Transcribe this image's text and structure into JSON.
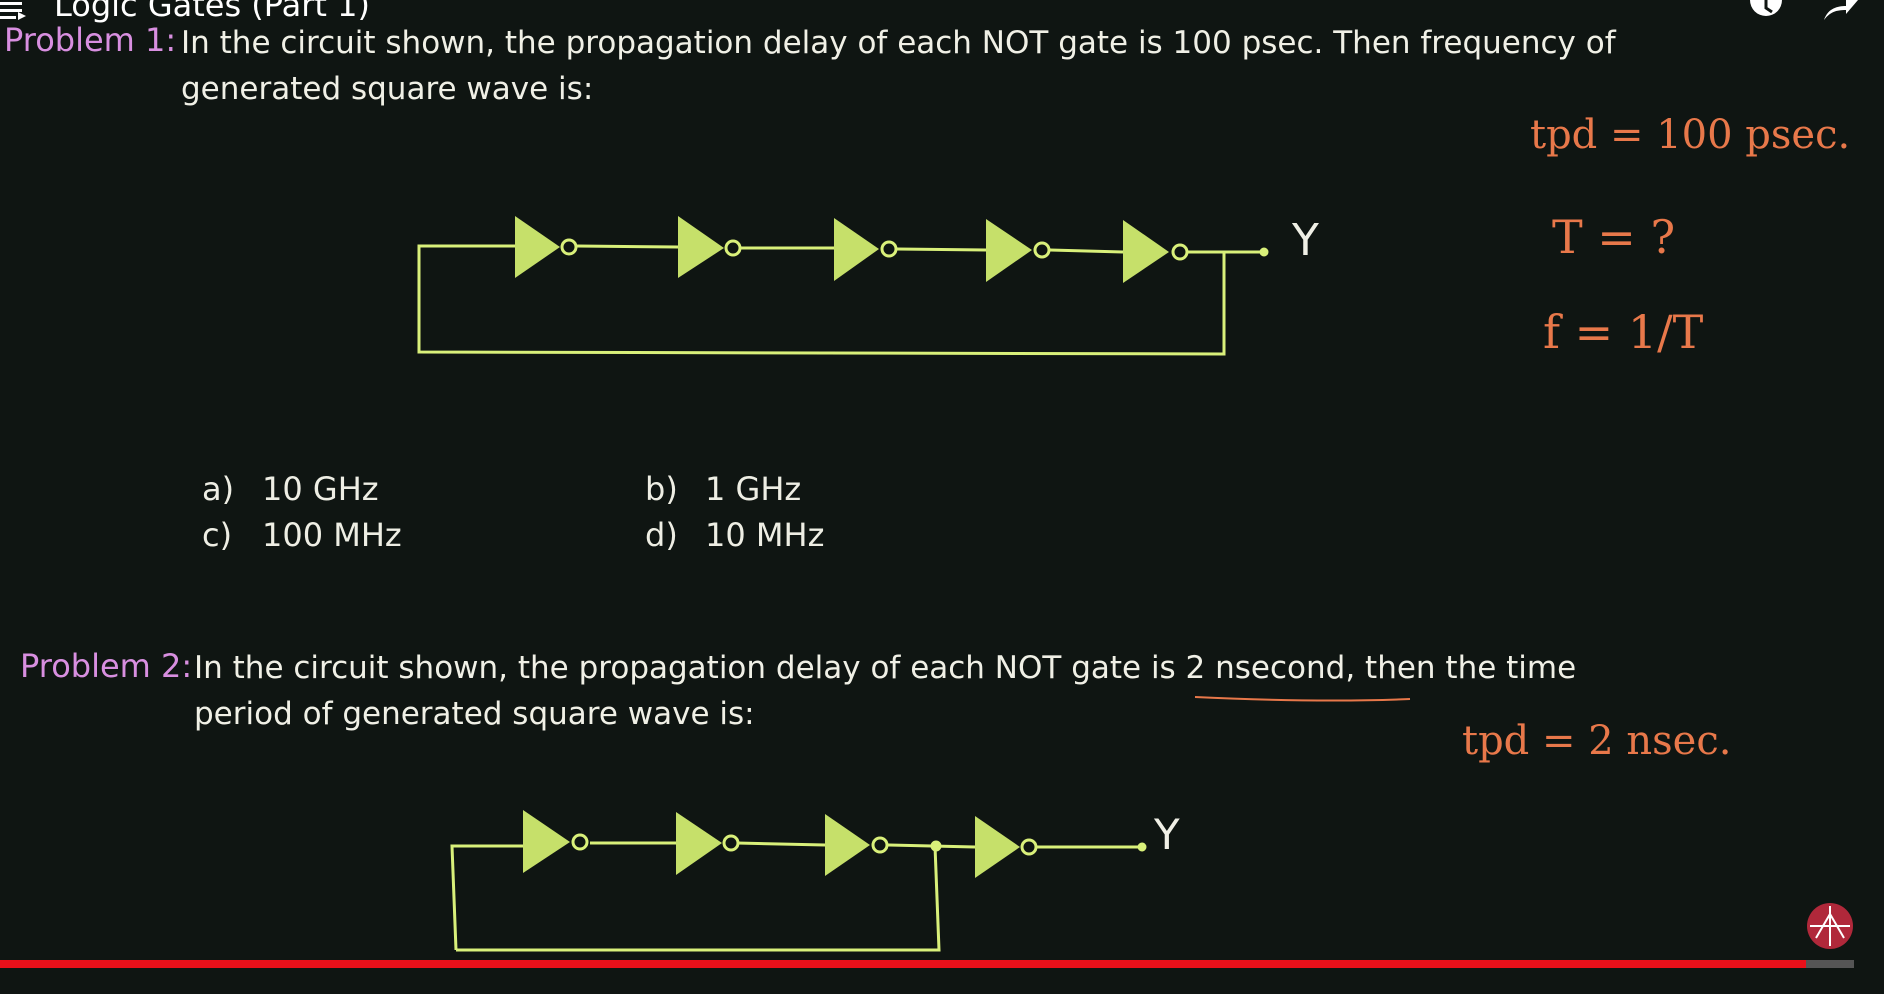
{
  "player": {
    "title": "Logic Gates (Part 1)",
    "progress_percent": 97.4
  },
  "problem1": {
    "label": "Problem 1:",
    "line1": "In the circuit shown, the propagation delay of each NOT gate is 100 psec. Then frequency of",
    "line2": "generated square wave is:",
    "output_label": "Y",
    "options": [
      {
        "letter": "a)",
        "text": "10 GHz"
      },
      {
        "letter": "b)",
        "text": "1 GHz"
      },
      {
        "letter": "c)",
        "text": "100 MHz"
      },
      {
        "letter": "d)",
        "text": "10 MHz"
      }
    ],
    "notes": {
      "tpd": "tpd = 100 psec.",
      "period": "T = ?",
      "freq": "f = 1/T"
    }
  },
  "problem2": {
    "label": "Problem 2:",
    "line1": "In the circuit shown, the propagation delay of each NOT gate is 2 nsecond, then the time",
    "line2": "period of generated square wave is:",
    "output_label": "Y",
    "notes": {
      "tpd": "tpd = 2 nsec."
    }
  },
  "colors": {
    "background": "#0f1512",
    "wire": "#d9f07a",
    "gate_fill": "#c6e06a",
    "label": "#d88fe0",
    "handwriting": "#e8784a",
    "progress": "#e8101a"
  }
}
